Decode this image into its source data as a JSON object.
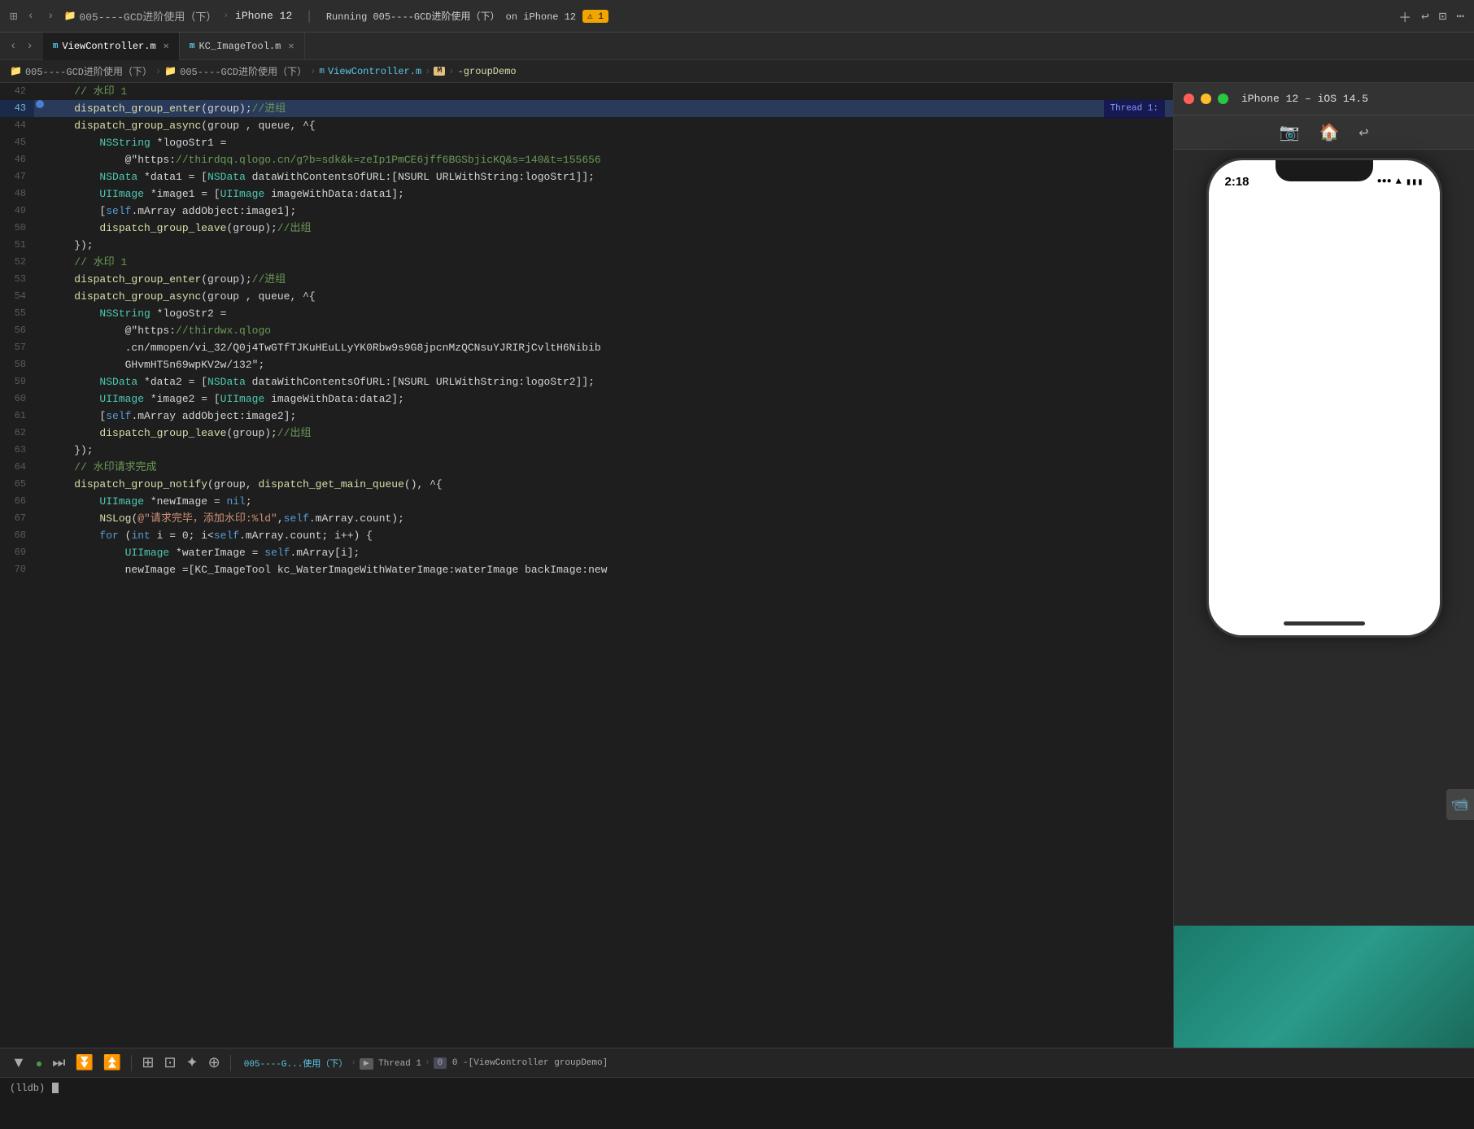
{
  "topbar": {
    "project": "005----GCD进阶使用（下）",
    "device": "iPhone 12",
    "run_status": "Running 005----GCD进阶使用（下） on iPhone 12",
    "warning_count": "1",
    "more_icon": "⋯"
  },
  "tabs": [
    {
      "id": "viewcontroller",
      "label": "ViewController.m",
      "icon": "m",
      "active": true
    },
    {
      "id": "kcimagetool",
      "label": "KC_ImageTool.m",
      "icon": "m",
      "active": false
    }
  ],
  "breadcrumb": [
    {
      "text": "005----GCD进阶使用（下）",
      "type": "folder"
    },
    {
      "text": "005----GCD进阶使用（下）",
      "type": "folder"
    },
    {
      "text": "ViewController.m",
      "type": "file"
    },
    {
      "text": "M",
      "type": "class"
    },
    {
      "text": "-groupDemo",
      "type": "method"
    }
  ],
  "code_lines": [
    {
      "num": 42,
      "content": "    // 水印 1",
      "type": "comment",
      "active": false
    },
    {
      "num": 43,
      "content": "    dispatch_group_enter(group);//进组",
      "type": "code",
      "active": true,
      "has_thread": true,
      "thread_label": "Thread 1:"
    },
    {
      "num": 44,
      "content": "    dispatch_group_async(group , queue, ^{",
      "type": "code"
    },
    {
      "num": 45,
      "content": "        NSString *logoStr1 =",
      "type": "code"
    },
    {
      "num": 46,
      "content": "            @\"https://thirdqq.qlogo.cn/g?b=sdk&k=zeIp1PmCE6jff6BGSbjicKQ&s=140&t=155656",
      "type": "string"
    },
    {
      "num": 47,
      "content": "        NSData *data1 = [NSData dataWithContentsOfURL:[NSURL URLWithString:logoStr1]];",
      "type": "code"
    },
    {
      "num": 48,
      "content": "        UIImage *image1 = [UIImage imageWithData:data1];",
      "type": "code"
    },
    {
      "num": 49,
      "content": "        [self.mArray addObject:image1];",
      "type": "code"
    },
    {
      "num": 50,
      "content": "        dispatch_group_leave(group);//出组",
      "type": "code"
    },
    {
      "num": 51,
      "content": "    });",
      "type": "code"
    },
    {
      "num": 52,
      "content": "    // 水印 1",
      "type": "comment"
    },
    {
      "num": 53,
      "content": "    dispatch_group_enter(group);//进组",
      "type": "code"
    },
    {
      "num": 54,
      "content": "    dispatch_group_async(group , queue, ^{",
      "type": "code"
    },
    {
      "num": 55,
      "content": "        NSString *logoStr2 =",
      "type": "code"
    },
    {
      "num": 56,
      "content": "            @\"https://thirdwx.qlogo",
      "type": "string"
    },
    {
      "num": 57,
      "content": "            .cn/mmopen/vi_32/Q0j4TwGTfTJKuHEuLLyYK0Rbw9s9G8jpcnMzQCNsuYJRIRjCvltH6Nibib",
      "type": "string"
    },
    {
      "num": 58,
      "content": "            GHvmHT5n69wpKV2w/132\";",
      "type": "string"
    },
    {
      "num": 59,
      "content": "        NSData *data2 = [NSData dataWithContentsOfURL:[NSURL URLWithString:logoStr2]];",
      "type": "code"
    },
    {
      "num": 60,
      "content": "        UIImage *image2 = [UIImage imageWithData:data2];",
      "type": "code"
    },
    {
      "num": 61,
      "content": "        [self.mArray addObject:image2];",
      "type": "code"
    },
    {
      "num": 62,
      "content": "        dispatch_group_leave(group);//出组",
      "type": "code"
    },
    {
      "num": 63,
      "content": "    });",
      "type": "code"
    },
    {
      "num": 64,
      "content": "    // 水印请求完成",
      "type": "comment"
    },
    {
      "num": 65,
      "content": "    dispatch_group_notify(group, dispatch_get_main_queue(), ^{",
      "type": "code"
    },
    {
      "num": 66,
      "content": "        UIImage *newImage = nil;",
      "type": "code"
    },
    {
      "num": 67,
      "content": "        NSLog(@\"请求完毕，添加水印:%ld\",self.mArray.count);",
      "type": "code"
    },
    {
      "num": 68,
      "content": "        for (int i = 0; i<self.mArray.count; i++) {",
      "type": "code"
    },
    {
      "num": 69,
      "content": "            UIImage *waterImage = self.mArray[i];",
      "type": "code"
    },
    {
      "num": 70,
      "content": "            newImage =[KC_ImageTool kc_WaterImageWithWaterImage:waterImage backImage:new",
      "type": "code"
    }
  ],
  "simulator": {
    "title": "iPhone 12 – iOS 14.5",
    "time": "2:18",
    "signal_bars": "●●●",
    "wifi_icon": "wifi",
    "battery_icon": "battery"
  },
  "debug_toolbar": {
    "buttons": [
      "▼",
      "▶",
      "⏭",
      "⏬",
      "⏫",
      "|",
      "⊞",
      "⊡",
      "✦",
      "⊕"
    ],
    "breadcrumb": "005----G...使用（下）  ▶  Thread 1  ▶  0 -[ViewController groupDemo]"
  },
  "console": {
    "prompt": "(lldb)"
  }
}
